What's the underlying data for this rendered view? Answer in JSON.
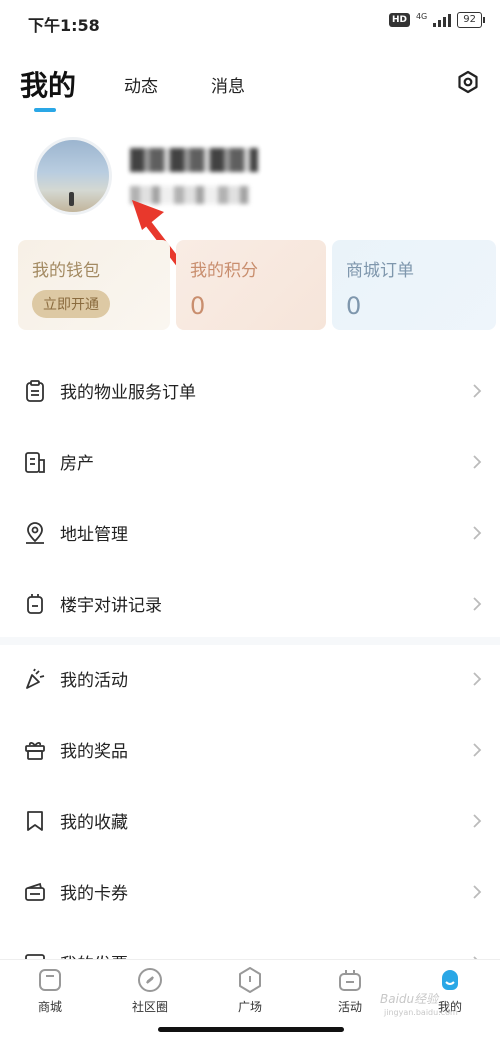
{
  "status_bar": {
    "time": "下午1:58",
    "hd": "HD",
    "network": "4G",
    "battery": "92"
  },
  "header": {
    "tabs": [
      {
        "label": "我的",
        "active": true
      },
      {
        "label": "动态",
        "active": false
      },
      {
        "label": "消息",
        "active": false
      }
    ],
    "settings_icon": "settings-icon"
  },
  "profile": {
    "avatar_icon": "avatar",
    "name_blurred": true,
    "subtitle_blurred": true
  },
  "cards": {
    "wallet": {
      "title": "我的钱包",
      "button": "立即开通"
    },
    "points": {
      "title": "我的积分",
      "value": "0"
    },
    "orders": {
      "title": "商城订单",
      "value": "0"
    }
  },
  "menu_group_1": [
    {
      "label": "我的物业服务订单",
      "icon": "clipboard-icon"
    },
    {
      "label": "房产",
      "icon": "building-icon"
    },
    {
      "label": "地址管理",
      "icon": "location-icon"
    },
    {
      "label": "楼宇对讲记录",
      "icon": "intercom-icon"
    }
  ],
  "menu_group_2": [
    {
      "label": "我的活动",
      "icon": "party-icon"
    },
    {
      "label": "我的奖品",
      "icon": "gift-icon"
    },
    {
      "label": "我的收藏",
      "icon": "bookmark-icon"
    },
    {
      "label": "我的卡券",
      "icon": "ticket-icon"
    },
    {
      "label": "我的发票",
      "icon": "invoice-icon"
    }
  ],
  "bottom_nav": [
    {
      "label": "商城",
      "icon": "shop-icon",
      "active": false
    },
    {
      "label": "社区圈",
      "icon": "compass-icon",
      "active": false
    },
    {
      "label": "广场",
      "icon": "square-icon",
      "active": false
    },
    {
      "label": "活动",
      "icon": "activity-icon",
      "active": false
    },
    {
      "label": "我的",
      "icon": "profile-icon",
      "active": true
    }
  ],
  "colors": {
    "accent": "#2aa7e6",
    "wallet_text": "#a38a62",
    "points_text": "#c98e6e",
    "orders_text": "#7f97ad",
    "arrow": "#e8382c"
  },
  "watermark": {
    "text": "Baidu经验",
    "url_text": "jingyan.baidu.com"
  }
}
